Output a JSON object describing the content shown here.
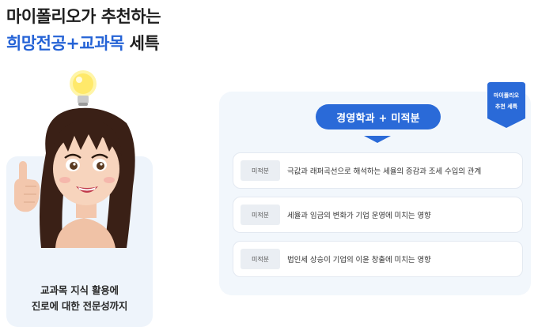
{
  "headline": {
    "line1": "마이폴리오가 추천하는",
    "line2_highlight": "희망전공+교과목",
    "line2_rest": " 세특"
  },
  "left_card": {
    "caption_line1": "교과목 지식 활용에",
    "caption_line2": "진로에 대한 전문성까지"
  },
  "ribbon": {
    "line1": "마이폴리오",
    "line2": "추천 세특"
  },
  "pill": {
    "label": "경영학과  +  미적분"
  },
  "rows": [
    {
      "badge": "미적분",
      "text": "극값과 래퍼곡선으로 해석하는 세율의 증감과 조세 수입의 관계"
    },
    {
      "badge": "미적분",
      "text": "세율과 임금의 변화가 기업 운영에 미치는 영향"
    },
    {
      "badge": "미적분",
      "text": "법인세 상승이 기업의 이윤 창출에 미치는 영향"
    }
  ],
  "colors": {
    "accent": "#2563d6",
    "pill": "#2a6ad8",
    "panel_bg": "#f2f7fc",
    "card_bg": "#eef4fb"
  },
  "icons": [
    "lightbulb-icon",
    "avatar-illustration",
    "bookmark-ribbon-icon"
  ]
}
